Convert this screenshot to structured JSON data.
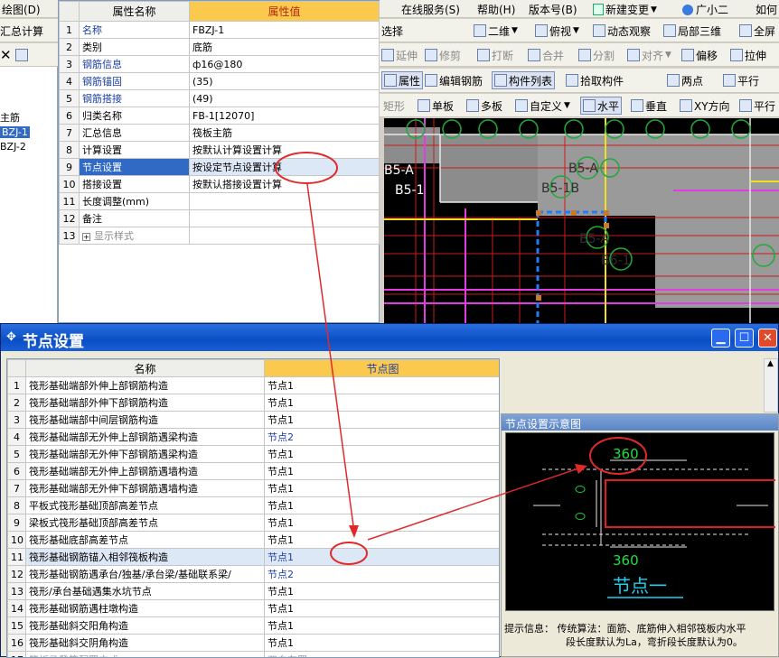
{
  "menubar": {
    "items": [
      "绘图(D)",
      "在线服务(S)",
      "帮助(H)",
      "版本号(B)",
      "新建变更",
      "广小二",
      "如何"
    ]
  },
  "toolbar1": {
    "items": [
      "汇总计算",
      "选择",
      "二维",
      "俯视",
      "动态观察",
      "局部三维",
      "全屏"
    ]
  },
  "toolbar2": {
    "items": [
      "延伸",
      "修剪",
      "打断",
      "合并",
      "分割",
      "对齐",
      "偏移",
      "拉伸"
    ]
  },
  "toolbar3": {
    "items": [
      "属性",
      "编辑钢筋",
      "构件列表",
      "拾取构件",
      "两点",
      "平行"
    ]
  },
  "toolbar4": {
    "items": [
      "矩形",
      "单板",
      "多板",
      "自定义",
      "水平",
      "垂直",
      "XY方向",
      "平行"
    ]
  },
  "tree": {
    "items": [
      "主筋",
      "BZJ-1",
      "BZJ-2"
    ]
  },
  "property_grid": {
    "col_name": "属性名称",
    "col_value": "属性值",
    "rows": [
      {
        "n": "1",
        "name": "名称",
        "value": "FBZJ-1"
      },
      {
        "n": "2",
        "name": "类别",
        "value": "底筋"
      },
      {
        "n": "3",
        "name": "钢筋信息",
        "value": "ф16@180"
      },
      {
        "n": "4",
        "name": "钢筋锚固",
        "value": "(35)"
      },
      {
        "n": "5",
        "name": "钢筋搭接",
        "value": "(49)"
      },
      {
        "n": "6",
        "name": "归类名称",
        "value": "FB-1[12070]"
      },
      {
        "n": "7",
        "name": "汇总信息",
        "value": "筏板主筋"
      },
      {
        "n": "8",
        "name": "计算设置",
        "value": "按默认计算设置计算"
      },
      {
        "n": "9",
        "name": "节点设置",
        "value": "按设定节点设置计算"
      },
      {
        "n": "10",
        "name": "搭接设置",
        "value": "按默认搭接设置计算"
      },
      {
        "n": "11",
        "name": "长度调整(mm)",
        "value": ""
      },
      {
        "n": "12",
        "name": "备注",
        "value": ""
      },
      {
        "n": "13",
        "name": "显示样式",
        "value": ""
      }
    ]
  },
  "cad": {
    "labels": [
      "B5-A",
      "B5-1",
      "B5-A",
      "B5-1B",
      "B5-A",
      "B6-1"
    ]
  },
  "dialog": {
    "title": "节点设置",
    "col_name": "名称",
    "col_value": "节点图",
    "rows": [
      {
        "n": "1",
        "name": "筏形基础端部外伸上部钢筋构造",
        "value": "节点1"
      },
      {
        "n": "2",
        "name": "筏形基础端部外伸下部钢筋构造",
        "value": "节点1"
      },
      {
        "n": "3",
        "name": "筏形基础端部中间层钢筋构造",
        "value": "节点1"
      },
      {
        "n": "4",
        "name": "筏形基础端部无外伸上部钢筋遇梁构造",
        "value": "节点2"
      },
      {
        "n": "5",
        "name": "筏形基础端部无外伸下部钢筋遇梁构造",
        "value": "节点1"
      },
      {
        "n": "6",
        "name": "筏形基础端部无外伸上部钢筋遇墙构造",
        "value": "节点1"
      },
      {
        "n": "7",
        "name": "筏形基础端部无外伸下部钢筋遇墙构造",
        "value": "节点1"
      },
      {
        "n": "8",
        "name": "平板式筏形基础顶部高差节点",
        "value": "节点1"
      },
      {
        "n": "9",
        "name": "梁板式筏形基础顶部高差节点",
        "value": "节点1"
      },
      {
        "n": "10",
        "name": "筏形基础底部高差节点",
        "value": "节点1"
      },
      {
        "n": "11",
        "name": "筏形基础钢筋锚入相邻筏板构造",
        "value": "节点1"
      },
      {
        "n": "12",
        "name": "筏形基础钢筋遇承台/独基/承台梁/基础联系梁/",
        "value": "节点2"
      },
      {
        "n": "13",
        "name": "筏形/承台基础遇集水坑节点",
        "value": "节点1"
      },
      {
        "n": "14",
        "name": "筏形基础钢筋遇柱墩构造",
        "value": "节点1"
      },
      {
        "n": "15",
        "name": "筏形基础斜交阳角构造",
        "value": "节点1"
      },
      {
        "n": "16",
        "name": "筏形基础斜交阴角构造",
        "value": "节点1"
      },
      {
        "n": "17",
        "name": "筏板马凳筋配置方式",
        "value": "双向布置"
      }
    ],
    "preview": {
      "title": "节点设置示意图",
      "dim_top": "360",
      "dim_bottom": "360",
      "caption": "节点一",
      "hint_label": "提示信息：",
      "hint_line1": "传统算法：面筋、底筋伸入相邻筏板内水平",
      "hint_line2": "段长度默认为La，弯折段长度默认为0。"
    }
  }
}
